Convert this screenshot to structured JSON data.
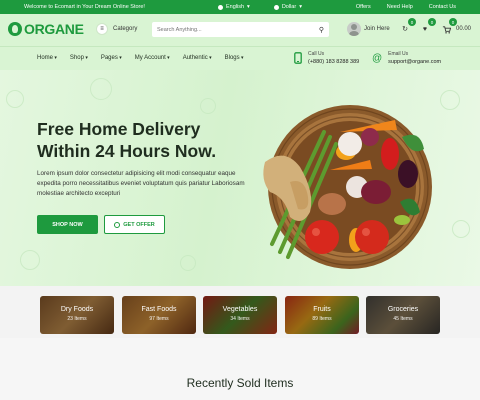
{
  "topbar": {
    "welcome": "Welcome to Ecomart in Your Dream Online Store!",
    "language": "English",
    "currency": "Dollar",
    "links": [
      "Offers",
      "Need Help",
      "Contact Us"
    ]
  },
  "header": {
    "logo": "ORGANE",
    "category_label": "Category",
    "search_placeholder": "Search Anything...",
    "join_label": "Join Here",
    "badges": {
      "compare": "0",
      "wishlist": "0",
      "cart": "0"
    },
    "cart_total": "00.00"
  },
  "nav": {
    "items": [
      "Home",
      "Shop",
      "Pages",
      "My Account",
      "Authentic",
      "Blogs"
    ],
    "call_label": "Call Us",
    "call_value": "(+880) 183 8288 389",
    "email_label": "Email Us",
    "email_value": "support@organe.com"
  },
  "hero": {
    "title": "Free Home Delivery Within 24 Hours Now.",
    "body": "Lorem ipsum dolor consectetur adipisicing elit modi consequatur eaque expedita porro necessitatibus eveniet voluptatum quis pariatur Laboriosam molestiae architecto excepturi",
    "shop_button": "SHOP NOW",
    "offer_button": "GET OFFER"
  },
  "categories": [
    {
      "name": "Dry Foods",
      "count": "23 Items"
    },
    {
      "name": "Fast Foods",
      "count": "97 Items"
    },
    {
      "name": "Vegetables",
      "count": "34 Items"
    },
    {
      "name": "Fruits",
      "count": "89 Items"
    },
    {
      "name": "Groceries",
      "count": "45 Items"
    }
  ],
  "recent": {
    "title": "Recently Sold Items"
  },
  "colors": {
    "brand": "#1e9a3e",
    "hero_bg": "#d5f2ce"
  }
}
